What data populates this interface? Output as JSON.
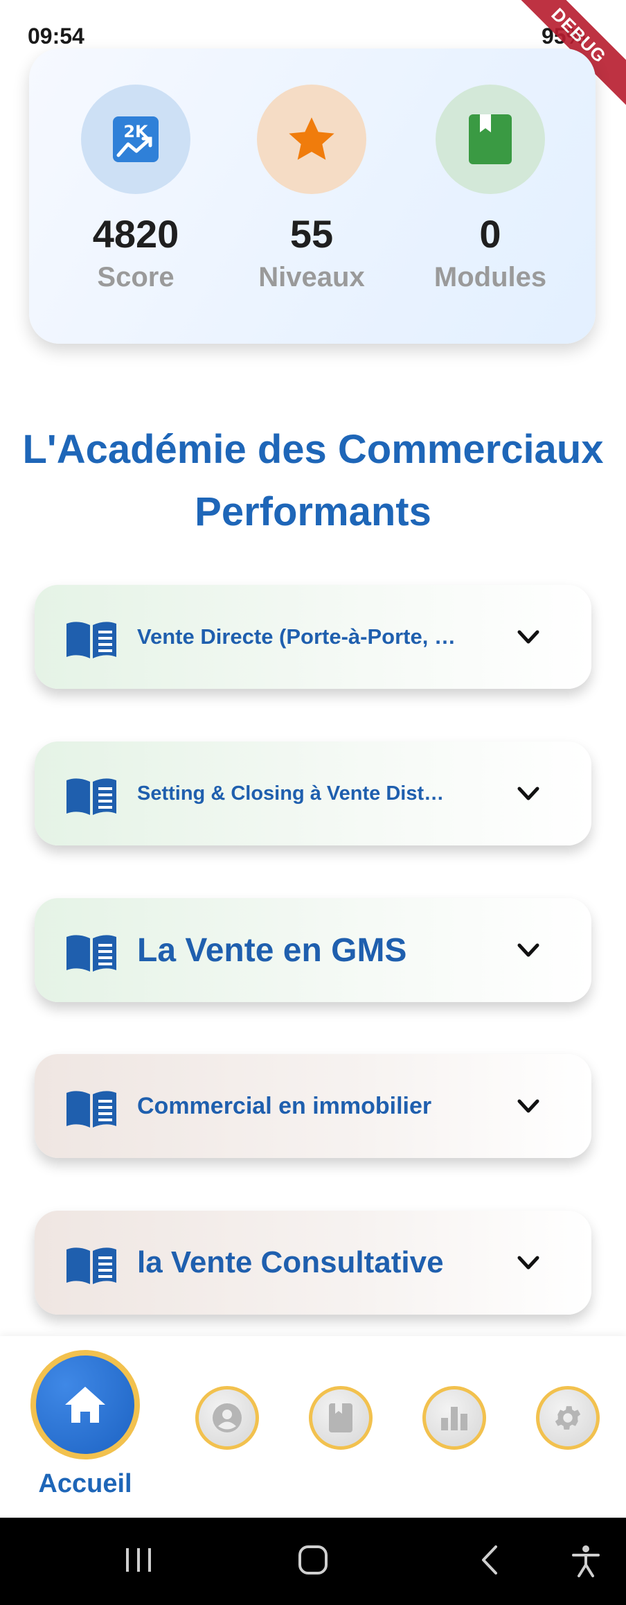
{
  "status_bar": {
    "time": "09:54",
    "battery": "95%",
    "debug_banner": "DEBUG"
  },
  "stats": [
    {
      "icon": "chart-trend-icon",
      "value": "4820",
      "label": "Score",
      "circle_color": "#cde0f5",
      "icon_color": "#2f80d8"
    },
    {
      "icon": "star-icon",
      "value": "55",
      "label": "Niveaux",
      "circle_color": "#f5dcc5",
      "icon_color": "#f07c0c"
    },
    {
      "icon": "book-icon",
      "value": "0",
      "label": "Modules",
      "circle_color": "#d3e8d8",
      "icon_color": "#3a9a43"
    }
  ],
  "title": "L'Académie des Commerciaux Performants",
  "modules": [
    {
      "label": "Vente Directe (Porte-à-Porte, …",
      "style": "green"
    },
    {
      "label": "Setting & Closing à Vente Dist…",
      "style": "green"
    },
    {
      "label": "La Vente en GMS",
      "style": "green"
    },
    {
      "label": "Commercial en immobilier",
      "style": "beige"
    },
    {
      "label": "la Vente Consultative",
      "style": "beige"
    }
  ],
  "bottom_nav": {
    "active_label": "Accueil",
    "items": [
      "home-icon",
      "profile-icon",
      "book-icon",
      "bar-chart-icon",
      "settings-icon"
    ]
  },
  "colors": {
    "accent": "#1e66b8",
    "nav_ring": "#f2c14e"
  }
}
